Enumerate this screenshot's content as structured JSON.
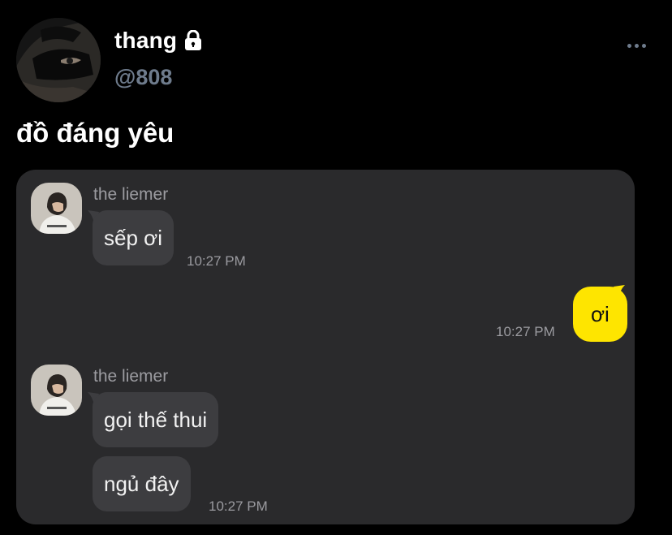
{
  "header": {
    "display_name": "thang",
    "handle": "@808",
    "lock_icon": "lock-icon",
    "more_icon": "more-dots-icon"
  },
  "tweet": {
    "text": "đồ đáng yêu"
  },
  "chat": {
    "messages": [
      {
        "sender": "the liemer",
        "bubbles": [
          "sếp ơi"
        ],
        "time": "10:27 PM",
        "side": "left"
      },
      {
        "sender": "",
        "bubbles": [
          "ơi"
        ],
        "time": "10:27 PM",
        "side": "right"
      },
      {
        "sender": "the liemer",
        "bubbles": [
          "gọi thế thui",
          "ngủ đây"
        ],
        "time": "10:27 PM",
        "side": "left"
      }
    ]
  },
  "colors": {
    "background": "#000000",
    "card": "#2a2a2c",
    "bubble_other": "#3d3d40",
    "bubble_mine": "#fee500",
    "handle": "#6e7b8c",
    "meta_text": "#9b9ba0"
  }
}
